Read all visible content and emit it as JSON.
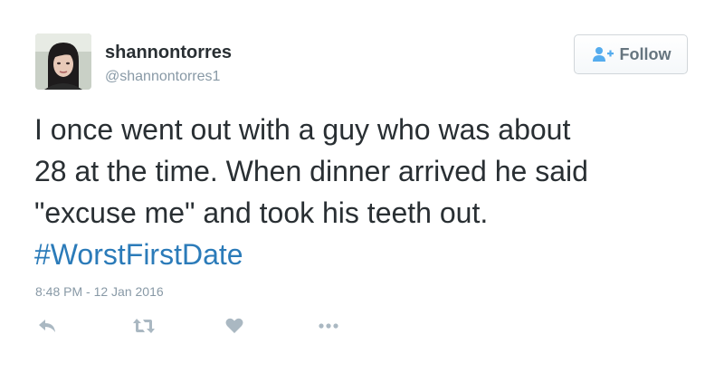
{
  "user": {
    "display_name": "shannontorres",
    "screen_name": "@shannontorres1"
  },
  "follow_button": {
    "label": "Follow",
    "icon": "add-user-icon"
  },
  "tweet": {
    "text_lines": [
      "I once went out with a guy who was about",
      "28 at the time. When dinner arrived he said",
      "\"excuse me\" and took his teeth out."
    ],
    "hashtag": "#WorstFirstDate",
    "timestamp": "8:48 PM - 12 Jan 2016"
  },
  "actions": [
    {
      "name": "reply",
      "icon": "reply-icon"
    },
    {
      "name": "retweet",
      "icon": "retweet-icon"
    },
    {
      "name": "like",
      "icon": "heart-icon"
    },
    {
      "name": "more",
      "icon": "more-icon"
    }
  ],
  "colors": {
    "text": "#292f33",
    "muted": "#8899a6",
    "link": "#2b7bb9",
    "icon": "#aab8c2",
    "follow_icon": "#55acee"
  }
}
